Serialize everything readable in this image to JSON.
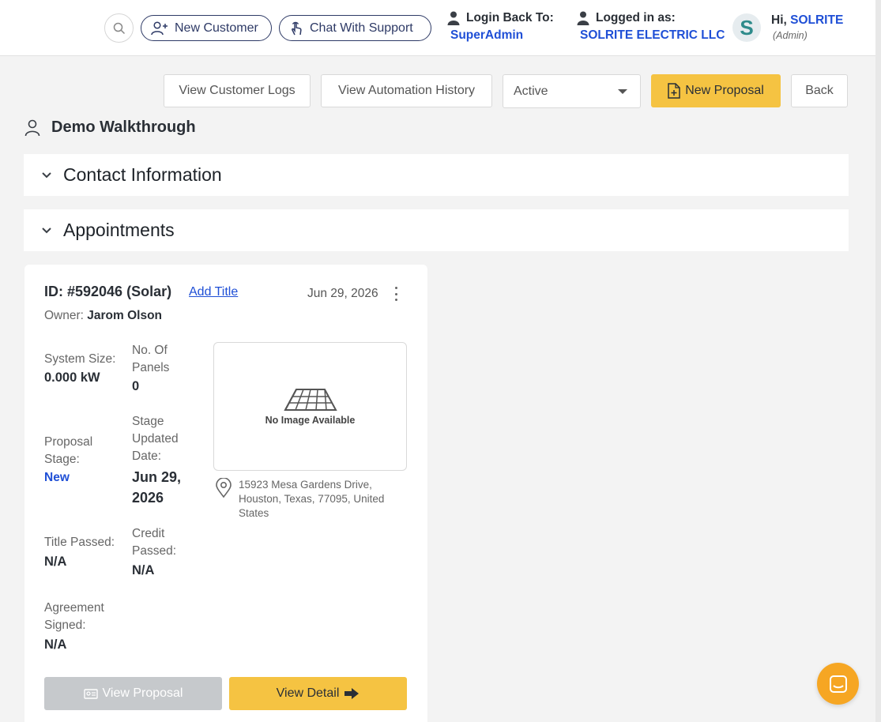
{
  "header": {
    "new_customer_label": "New Customer",
    "chat_support_label": "Chat With Support",
    "login_back_label": "Login Back To:",
    "login_back_value": "SuperAdmin",
    "logged_in_label": "Logged in as:",
    "logged_in_value": "SOLRITE ELECTRIC LLC",
    "avatar_letter": "S",
    "greeting": "Hi,",
    "user_name": "SOLRITE",
    "user_role": "(Admin)"
  },
  "actions": {
    "view_logs": "View Customer Logs",
    "view_automation": "View Automation History",
    "status_value": "Active",
    "new_proposal": "New Proposal",
    "back": "Back"
  },
  "customer": {
    "name": "Demo Walkthrough"
  },
  "sections": {
    "contact": "Contact Information",
    "appointments": "Appointments"
  },
  "appointment": {
    "id": "ID: #592046 (Solar)",
    "add_title": "Add Title",
    "date": "Jun 29, 2026",
    "owner_label": "Owner:",
    "owner_name": "Jarom Olson",
    "system_size_label": "System Size:",
    "system_size_value": "0.000 kW",
    "panels_label": "No. Of Panels",
    "panels_value": "0",
    "proposal_stage_label": "Proposal Stage:",
    "proposal_stage_value": "New",
    "stage_updated_label": "Stage Updated Date:",
    "stage_updated_value": "Jun 29, 2026",
    "title_passed_label": "Title Passed:",
    "title_passed_value": "N/A",
    "credit_passed_label": "Credit Passed:",
    "credit_passed_value": "N/A",
    "agreement_label": "Agreement Signed:",
    "agreement_value": "N/A",
    "no_image": "No Image Available",
    "address": "15923 Mesa Gardens Drive, Houston, Texas, 77095, United States",
    "view_proposal": "View Proposal",
    "view_detail": "View Detail"
  },
  "colors": {
    "accent_yellow": "#f5c342",
    "link_blue": "#1f4fd6",
    "chat_orange": "#f6a623"
  },
  "icons": [
    "search-icon",
    "user-plus-icon",
    "hand-icon",
    "person-icon",
    "file-plus-icon",
    "chevron-down-icon",
    "roof-panel-icon",
    "map-pin-icon",
    "id-card-icon",
    "arrow-right-icon",
    "chat-icon"
  ]
}
